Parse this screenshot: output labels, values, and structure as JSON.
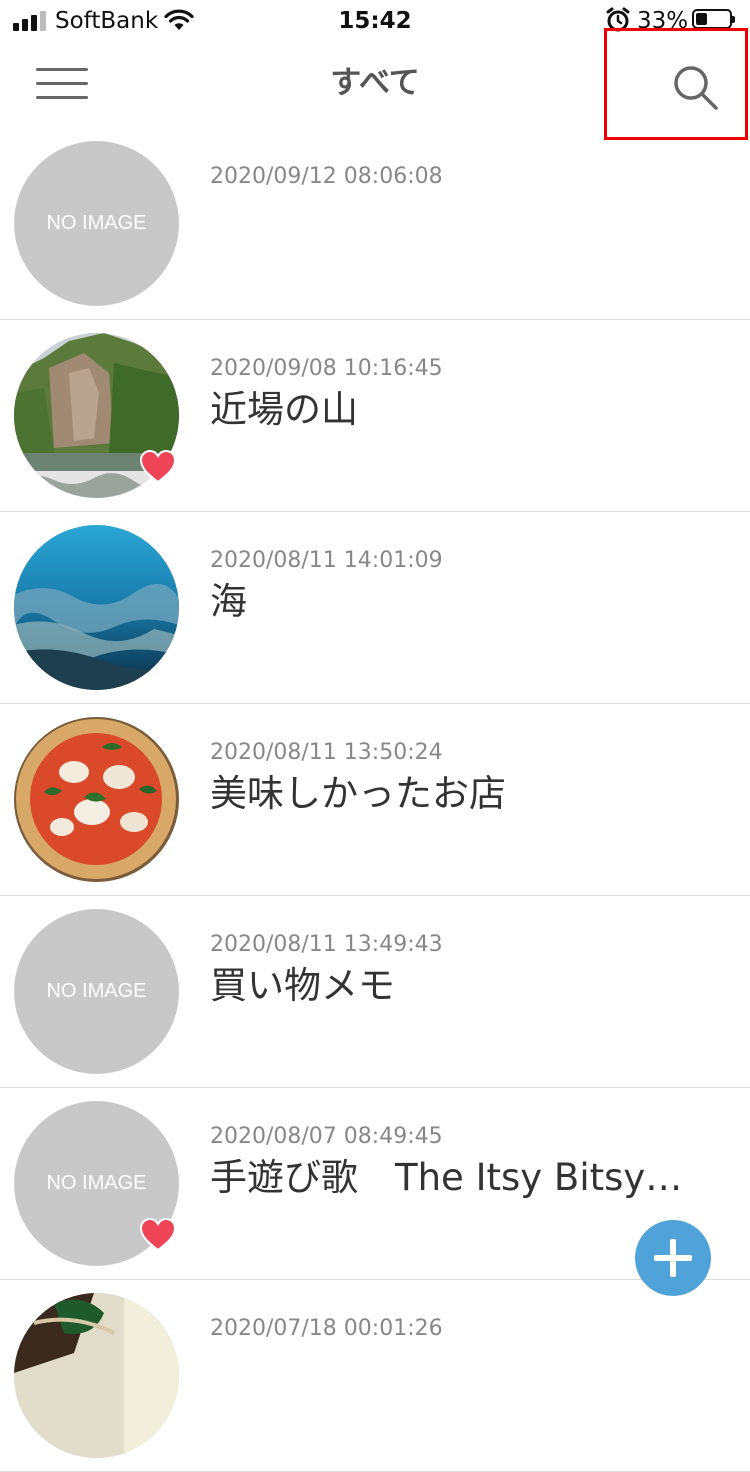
{
  "status_bar": {
    "carrier": "SoftBank",
    "time": "15:42",
    "battery_percent": "33%",
    "battery_level": 0.33,
    "icons": [
      "signal-icon",
      "wifi-icon",
      "alarm-icon",
      "battery-icon"
    ]
  },
  "nav": {
    "title": "すべて",
    "menu_icon": "hamburger-menu-icon",
    "search_icon": "search-icon",
    "highlight_color": "#ee0000"
  },
  "colors": {
    "accent": "#4fa3d8",
    "heart": "#ee4455",
    "placeholder": "#c8c8c8"
  },
  "memos": [
    {
      "date": "2020/09/12 08:06:08",
      "title": "",
      "image": "NO IMAGE",
      "favorite": false
    },
    {
      "date": "2020/09/08 10:16:45",
      "title": "近場の山",
      "image": "mountain-photo",
      "favorite": true
    },
    {
      "date": "2020/08/11 14:01:09",
      "title": "海",
      "image": "sea-photo",
      "favorite": false
    },
    {
      "date": "2020/08/11 13:50:24",
      "title": "美味しかったお店",
      "image": "pizza-photo",
      "favorite": false
    },
    {
      "date": "2020/08/11 13:49:43",
      "title": "買い物メモ",
      "image": "NO IMAGE",
      "favorite": false
    },
    {
      "date": "2020/08/07 08:49:45",
      "title": "手遊び歌　The Itsy Bitsy…",
      "image": "NO IMAGE",
      "favorite": true
    },
    {
      "date": "2020/07/18 00:01:26",
      "title": "",
      "image": "guitar-photo",
      "favorite": false
    }
  ],
  "fab": {
    "icon": "plus-icon"
  }
}
